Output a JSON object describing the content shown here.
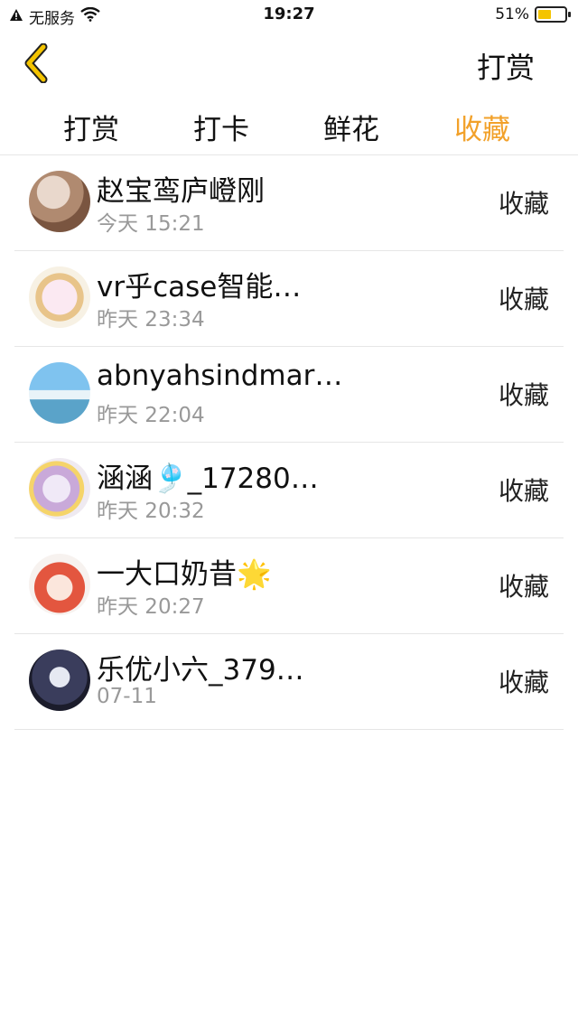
{
  "status": {
    "carrier": "无服务",
    "time": "19:27",
    "battery_percent": "51%",
    "battery_level": 0.51
  },
  "nav": {
    "action_label": "打赏"
  },
  "tabs": [
    {
      "label": "打赏",
      "active": false
    },
    {
      "label": "打卡",
      "active": false
    },
    {
      "label": "鲜花",
      "active": false
    },
    {
      "label": "收藏",
      "active": true
    }
  ],
  "colors": {
    "accent": "#f2a12a",
    "back_arrow": "#f4c400",
    "divider": "#e6e6e6",
    "secondary_text": "#999999"
  },
  "rows": [
    {
      "name": "赵宝鸾庐嶝刚",
      "time": "今天 15:21",
      "action": "收藏"
    },
    {
      "name": "vr乎case智能…",
      "time": "昨天 23:34",
      "action": "收藏"
    },
    {
      "name": "abnyahsindmar…",
      "time": "昨天 22:04",
      "action": "收藏"
    },
    {
      "name": "涵涵🎐_17280…",
      "time": "昨天 20:32",
      "action": "收藏"
    },
    {
      "name": "一大口奶昔🌟",
      "time": "昨天 20:27",
      "action": "收藏"
    },
    {
      "name": "乐优小六_379…",
      "time": "07-11",
      "action": "收藏"
    }
  ]
}
